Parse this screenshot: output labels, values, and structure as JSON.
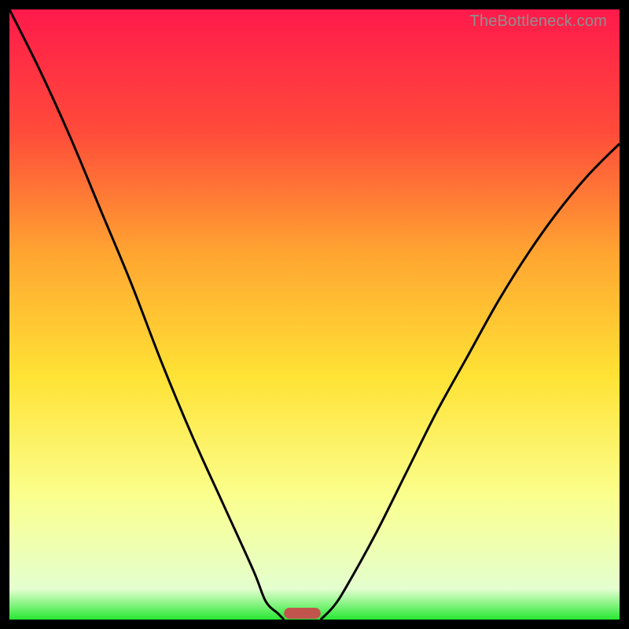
{
  "watermark": "TheBottleneck.com",
  "chart_data": {
    "type": "line",
    "title": "",
    "xlabel": "",
    "ylabel": "",
    "xlim": [
      0,
      100
    ],
    "ylim": [
      0,
      100
    ],
    "background_gradient_stops": [
      {
        "pct": 0,
        "color": "#ff1a4b"
      },
      {
        "pct": 20,
        "color": "#ff4b3a"
      },
      {
        "pct": 40,
        "color": "#ffa531"
      },
      {
        "pct": 60,
        "color": "#ffe234"
      },
      {
        "pct": 80,
        "color": "#faff8e"
      },
      {
        "pct": 95,
        "color": "#e4ffcf"
      },
      {
        "pct": 100,
        "color": "#27e833"
      }
    ],
    "series": [
      {
        "name": "left-curve",
        "x": [
          0,
          5,
          10,
          15,
          20,
          25,
          30,
          35,
          40,
          42,
          44,
          45
        ],
        "y": [
          100,
          90,
          79,
          67,
          55,
          42,
          30,
          19,
          8,
          3,
          1,
          0
        ]
      },
      {
        "name": "right-curve",
        "x": [
          51,
          53,
          55,
          60,
          65,
          70,
          75,
          80,
          85,
          90,
          95,
          100
        ],
        "y": [
          0,
          2,
          5,
          14,
          24,
          34,
          43,
          52,
          60,
          67,
          73,
          78
        ]
      }
    ],
    "marker": {
      "name": "bottleneck-marker",
      "x_center": 48,
      "width": 6,
      "color": "#c1554d"
    }
  }
}
